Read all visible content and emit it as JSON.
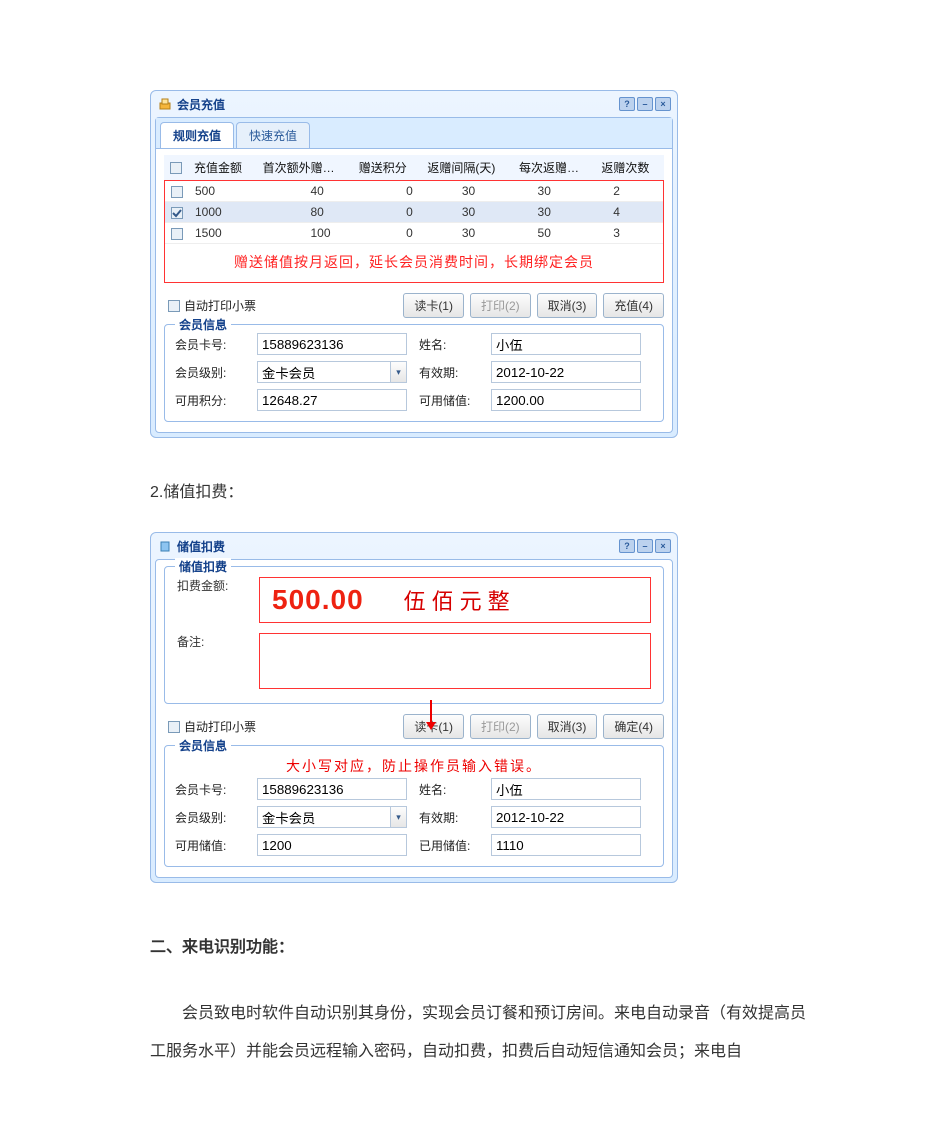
{
  "dialog1": {
    "title": "会员充值",
    "tabs": {
      "rule": "规则充值",
      "quick": "快速充值"
    },
    "headers": {
      "chk": "",
      "amount": "充值金额",
      "firstExtra": "首次额外赠…",
      "bonusPts": "赠送积分",
      "interval": "返赠间隔(天)",
      "each": "每次返赠…",
      "times": "返赠次数"
    },
    "rows": [
      {
        "checked": false,
        "amount": "500",
        "firstExtra": "40",
        "bonusPts": "0",
        "interval": "30",
        "each": "30",
        "times": "2"
      },
      {
        "checked": true,
        "amount": "1000",
        "firstExtra": "80",
        "bonusPts": "0",
        "interval": "30",
        "each": "30",
        "times": "4"
      },
      {
        "checked": false,
        "amount": "1500",
        "firstExtra": "100",
        "bonusPts": "0",
        "interval": "30",
        "each": "50",
        "times": "3"
      }
    ],
    "redNote": "赠送储值按月返回，延长会员消费时间，长期绑定会员",
    "autoPrint": "自动打印小票",
    "buttons": {
      "read": "读卡(1)",
      "print": "打印(2)",
      "cancel": "取消(3)",
      "ok": "充值(4)"
    },
    "member": {
      "legend": "会员信息",
      "cardNoLbl": "会员卡号:",
      "cardNo": "15889623136",
      "nameLbl": "姓名:",
      "name": "小伍",
      "levelLbl": "会员级别:",
      "level": "金卡会员",
      "validLbl": "有效期:",
      "valid": "2012-10-22",
      "ptsLbl": "可用积分:",
      "pts": "12648.27",
      "balLbl": "可用储值:",
      "bal": "1200.00"
    }
  },
  "sec2Label": "2.储值扣费：",
  "dialog2": {
    "title": "储值扣费",
    "innerTitle": "储值扣费",
    "fields": {
      "amountLbl": "扣费金额:",
      "remarkLbl": "备注:"
    },
    "amountValue": "500.00",
    "amountCn": "伍佰元整",
    "autoPrint": "自动打印小票",
    "buttons": {
      "read": "读卡(1)",
      "print": "打印(2)",
      "cancel": "取消(3)",
      "ok": "确定(4)"
    },
    "annot": "大小写对应，防止操作员输入错误。",
    "member": {
      "legend": "会员信息",
      "cardNoLbl": "会员卡号:",
      "cardNo": "15889623136",
      "nameLbl": "姓名:",
      "name": "小伍",
      "levelLbl": "会员级别:",
      "level": "金卡会员",
      "validLbl": "有效期:",
      "valid": "2012-10-22",
      "availLbl": "可用储值:",
      "avail": "1200",
      "usedLbl": "已用储值:",
      "used": "1110"
    }
  },
  "heading2": "二、来电识别功能：",
  "body": "会员致电时软件自动识别其身份，实现会员订餐和预订房间。来电自动录音（有效提高员工服务水平）并能会员远程输入密码，自动扣费，扣费后自动短信通知会员；来电自"
}
